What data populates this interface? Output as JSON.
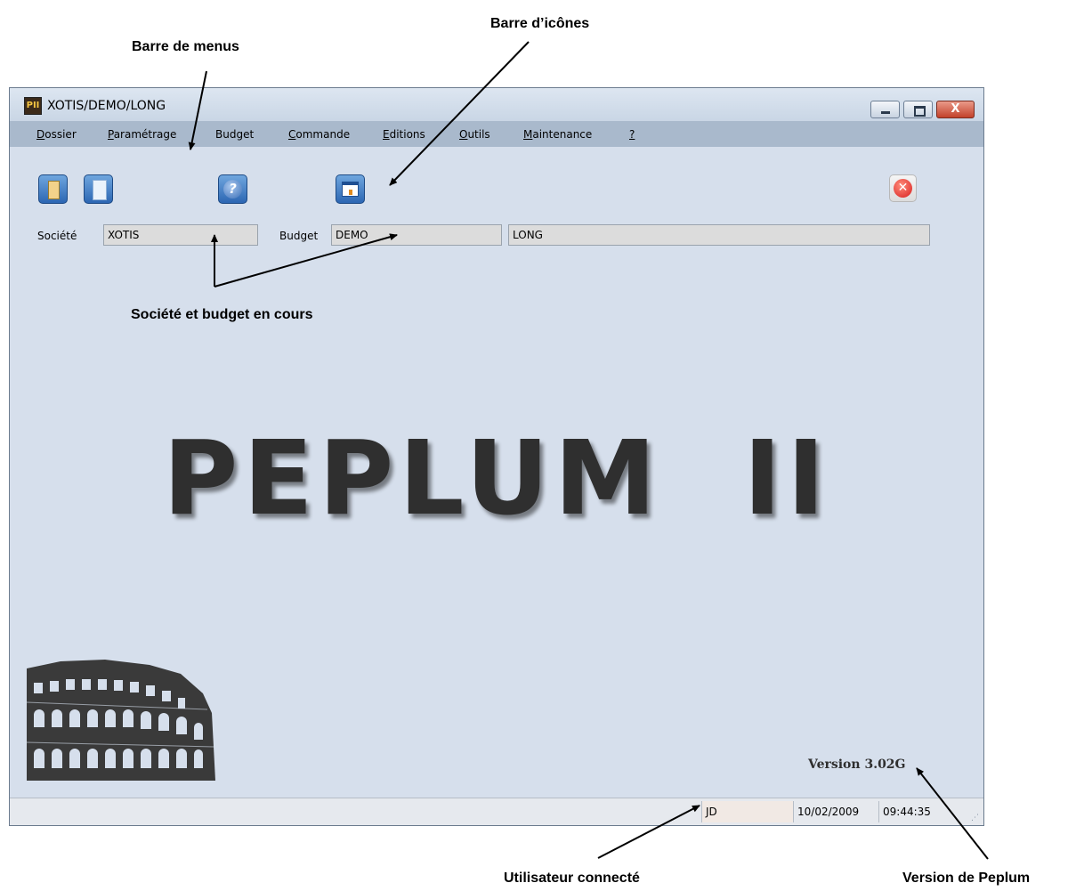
{
  "annotations": {
    "menu_bar": "Barre de menus",
    "icon_bar": "Barre d’icônes",
    "company_budget": "Société et budget en cours",
    "user": "Utilisateur connecté",
    "version": "Version de Peplum"
  },
  "window": {
    "title": "XOTIS/DEMO/LONG",
    "app_icon_letters": "PII",
    "close_glyph": "X"
  },
  "menu": {
    "dossier": {
      "u": "D",
      "rest": "ossier"
    },
    "parametrage": {
      "u": "P",
      "rest": "aramétrage"
    },
    "budget": {
      "u": "",
      "rest": "Budget"
    },
    "commande": {
      "u": "C",
      "rest": "ommande"
    },
    "editions": {
      "u": "E",
      "rest": "ditions"
    },
    "outils": {
      "u": "O",
      "rest": "utils"
    },
    "maintenance": {
      "u": "M",
      "rest": "aintenance"
    },
    "help": {
      "u": "?",
      "rest": ""
    }
  },
  "toolbar": {
    "help_glyph": "?",
    "quit_glyph": "✕"
  },
  "fields": {
    "societe_label": "Société",
    "societe_value": "XOTIS",
    "budget_label": "Budget",
    "budget_value": "DEMO",
    "budget_desc": "LONG"
  },
  "main": {
    "title": "PEPLUM  II",
    "version": "Version 3.02G"
  },
  "status": {
    "user": "JD",
    "date": "10/02/2009",
    "time": "09:44:35"
  }
}
